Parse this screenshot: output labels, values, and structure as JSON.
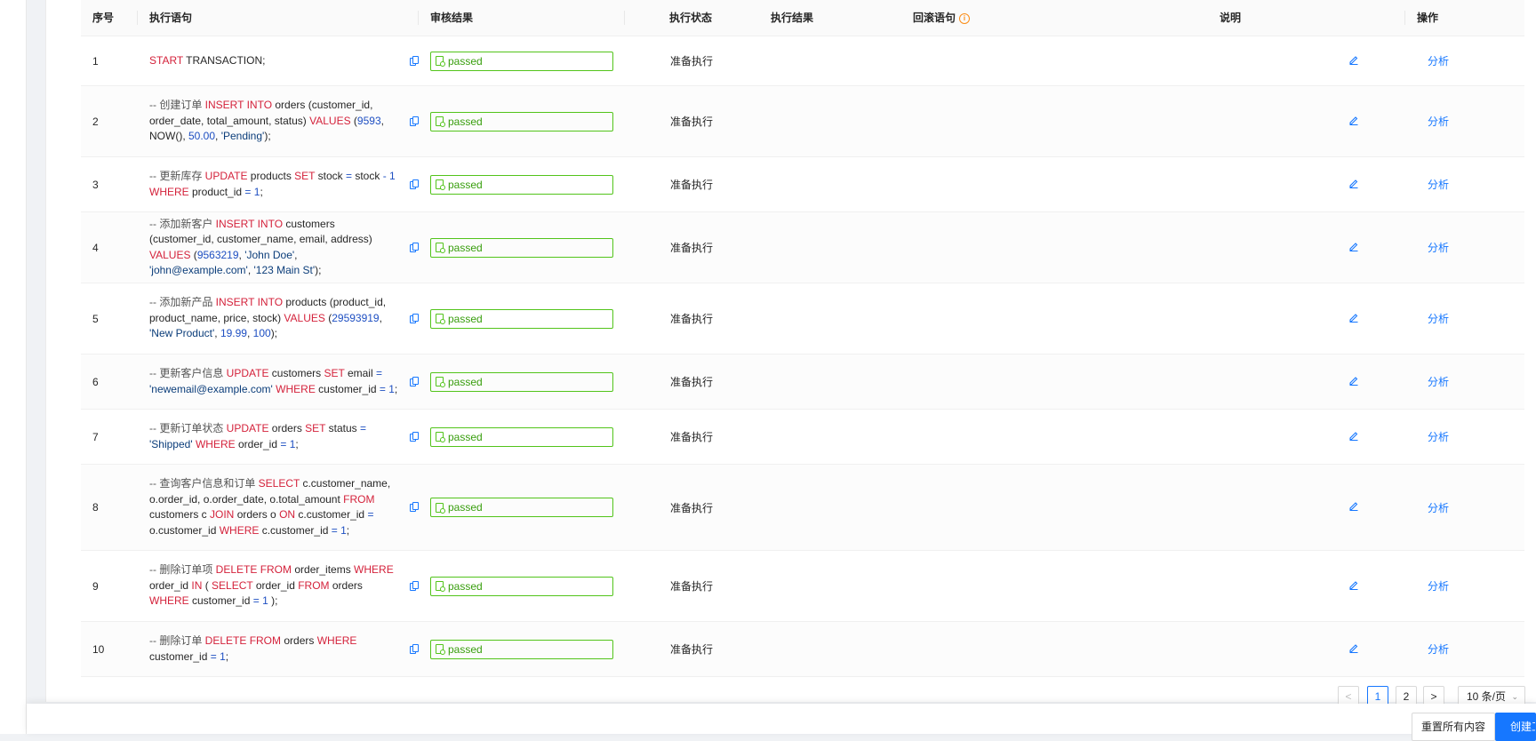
{
  "table": {
    "columns": {
      "index": "序号",
      "sql": "执行语句",
      "audit": "审核结果",
      "status": "执行状态",
      "result": "执行结果",
      "rollback": "回滚语句",
      "note": "说明",
      "op": "操作"
    },
    "rows": [
      {
        "index": "1",
        "status": "准备执行",
        "audit": "passed",
        "op": "分析"
      },
      {
        "index": "2",
        "status": "准备执行",
        "audit": "passed",
        "op": "分析"
      },
      {
        "index": "3",
        "status": "准备执行",
        "audit": "passed",
        "op": "分析"
      },
      {
        "index": "4",
        "status": "准备执行",
        "audit": "passed",
        "op": "分析"
      },
      {
        "index": "5",
        "status": "准备执行",
        "audit": "passed",
        "op": "分析"
      },
      {
        "index": "6",
        "status": "准备执行",
        "audit": "passed",
        "op": "分析"
      },
      {
        "index": "7",
        "status": "准备执行",
        "audit": "passed",
        "op": "分析"
      },
      {
        "index": "8",
        "status": "准备执行",
        "audit": "passed",
        "op": "分析"
      },
      {
        "index": "9",
        "status": "准备执行",
        "audit": "passed",
        "op": "分析"
      },
      {
        "index": "10",
        "status": "准备执行",
        "audit": "passed",
        "op": "分析"
      }
    ],
    "sql_tokens": [
      [
        [
          "kw",
          "START"
        ],
        [
          "t",
          " TRANSACTION;"
        ]
      ],
      [
        [
          "cm",
          "-- 创建订单 "
        ],
        [
          "kw",
          "INSERT INTO"
        ],
        [
          "t",
          " orders (customer_id, order_date, total_amount, status) "
        ],
        [
          "kw",
          "VALUES"
        ],
        [
          "t",
          " ("
        ],
        [
          "num",
          "9593"
        ],
        [
          "t",
          ", NOW(), "
        ],
        [
          "num",
          "50.00"
        ],
        [
          "t",
          ", "
        ],
        [
          "str",
          "'Pending'"
        ],
        [
          "t",
          ");"
        ]
      ],
      [
        [
          "cm",
          "-- 更新库存 "
        ],
        [
          "kw",
          "UPDATE"
        ],
        [
          "t",
          " products "
        ],
        [
          "kw",
          "SET"
        ],
        [
          "t",
          " stock "
        ],
        [
          "num",
          "="
        ],
        [
          "t",
          " stock "
        ],
        [
          "num",
          "-"
        ],
        [
          "t",
          " "
        ],
        [
          "num",
          "1"
        ],
        [
          "t",
          " "
        ],
        [
          "kw",
          "WHERE"
        ],
        [
          "t",
          " product_id "
        ],
        [
          "num",
          "="
        ],
        [
          "t",
          " "
        ],
        [
          "num",
          "1"
        ],
        [
          "t",
          ";"
        ]
      ],
      [
        [
          "cm",
          "-- 添加新客户 "
        ],
        [
          "kw",
          "INSERT INTO"
        ],
        [
          "t",
          " customers (customer_id, customer_name, email, address) "
        ],
        [
          "kw",
          "VALUES"
        ],
        [
          "t",
          " ("
        ],
        [
          "num",
          "9563219"
        ],
        [
          "t",
          ", "
        ],
        [
          "str",
          "'John Doe'"
        ],
        [
          "t",
          ", "
        ],
        [
          "str",
          "'john@example.com'"
        ],
        [
          "t",
          ", "
        ],
        [
          "str",
          "'123 Main St'"
        ],
        [
          "t",
          ");"
        ]
      ],
      [
        [
          "cm",
          "-- 添加新产品 "
        ],
        [
          "kw",
          "INSERT INTO"
        ],
        [
          "t",
          " products (product_id, product_name, price, stock) "
        ],
        [
          "kw",
          "VALUES"
        ],
        [
          "t",
          " ("
        ],
        [
          "num",
          "29593919"
        ],
        [
          "t",
          ", "
        ],
        [
          "str",
          "'New Product'"
        ],
        [
          "t",
          ", "
        ],
        [
          "num",
          "19.99"
        ],
        [
          "t",
          ", "
        ],
        [
          "num",
          "100"
        ],
        [
          "t",
          ");"
        ]
      ],
      [
        [
          "cm",
          "-- 更新客户信息 "
        ],
        [
          "kw",
          "UPDATE"
        ],
        [
          "t",
          " customers "
        ],
        [
          "kw",
          "SET"
        ],
        [
          "t",
          " email "
        ],
        [
          "num",
          "="
        ],
        [
          "t",
          " "
        ],
        [
          "str",
          "'newemail@example.com'"
        ],
        [
          "t",
          " "
        ],
        [
          "kw",
          "WHERE"
        ],
        [
          "t",
          " customer_id "
        ],
        [
          "num",
          "="
        ],
        [
          "t",
          " "
        ],
        [
          "num",
          "1"
        ],
        [
          "t",
          ";"
        ]
      ],
      [
        [
          "cm",
          "-- 更新订单状态 "
        ],
        [
          "kw",
          "UPDATE"
        ],
        [
          "t",
          " orders "
        ],
        [
          "kw",
          "SET"
        ],
        [
          "t",
          " status "
        ],
        [
          "num",
          "="
        ],
        [
          "t",
          " "
        ],
        [
          "str",
          "'Shipped'"
        ],
        [
          "t",
          " "
        ],
        [
          "kw",
          "WHERE"
        ],
        [
          "t",
          " order_id "
        ],
        [
          "num",
          "="
        ],
        [
          "t",
          " "
        ],
        [
          "num",
          "1"
        ],
        [
          "t",
          ";"
        ]
      ],
      [
        [
          "cm",
          "-- 查询客户信息和订单 "
        ],
        [
          "kw",
          "SELECT"
        ],
        [
          "t",
          " c.customer_name, o.order_id, o.order_date, o.total_amount "
        ],
        [
          "kw",
          "FROM"
        ],
        [
          "t",
          " customers c "
        ],
        [
          "kw",
          "JOIN"
        ],
        [
          "t",
          " orders o "
        ],
        [
          "kw",
          "ON"
        ],
        [
          "t",
          " c.customer_id "
        ],
        [
          "num",
          "="
        ],
        [
          "t",
          " o.customer_id "
        ],
        [
          "kw",
          "WHERE"
        ],
        [
          "t",
          " c.customer_id "
        ],
        [
          "num",
          "="
        ],
        [
          "t",
          " "
        ],
        [
          "num",
          "1"
        ],
        [
          "t",
          ";"
        ]
      ],
      [
        [
          "cm",
          "-- 删除订单项 "
        ],
        [
          "kw",
          "DELETE FROM"
        ],
        [
          "t",
          " order_items "
        ],
        [
          "kw",
          "WHERE"
        ],
        [
          "t",
          " order_id "
        ],
        [
          "kw",
          "IN"
        ],
        [
          "t",
          " ( "
        ],
        [
          "kw",
          "SELECT"
        ],
        [
          "t",
          " order_id "
        ],
        [
          "kw",
          "FROM"
        ],
        [
          "t",
          " orders "
        ],
        [
          "kw",
          "WHERE"
        ],
        [
          "t",
          " customer_id "
        ],
        [
          "num",
          "="
        ],
        [
          "t",
          " "
        ],
        [
          "num",
          "1"
        ],
        [
          "t",
          " );"
        ]
      ],
      [
        [
          "cm",
          "-- 删除订单 "
        ],
        [
          "kw",
          "DELETE FROM"
        ],
        [
          "t",
          " orders "
        ],
        [
          "kw",
          "WHERE"
        ],
        [
          "t",
          " customer_id "
        ],
        [
          "num",
          "="
        ],
        [
          "t",
          " "
        ],
        [
          "num",
          "1"
        ],
        [
          "t",
          ";"
        ]
      ]
    ]
  },
  "pagination": {
    "prev": "<",
    "page1": "1",
    "page2": "2",
    "next": ">",
    "page_size": "10 条/页"
  },
  "footer": {
    "reset_label": "重置所有内容",
    "create_label": "创建工单"
  },
  "colors": {
    "primary": "#1677ff",
    "passed": "#52c41a",
    "keyword": "#d4223b",
    "number": "#1e4fc2"
  },
  "icons": [
    "copy-icon",
    "passed-icon",
    "edit-icon",
    "info-icon",
    "chevron-down-icon"
  ]
}
